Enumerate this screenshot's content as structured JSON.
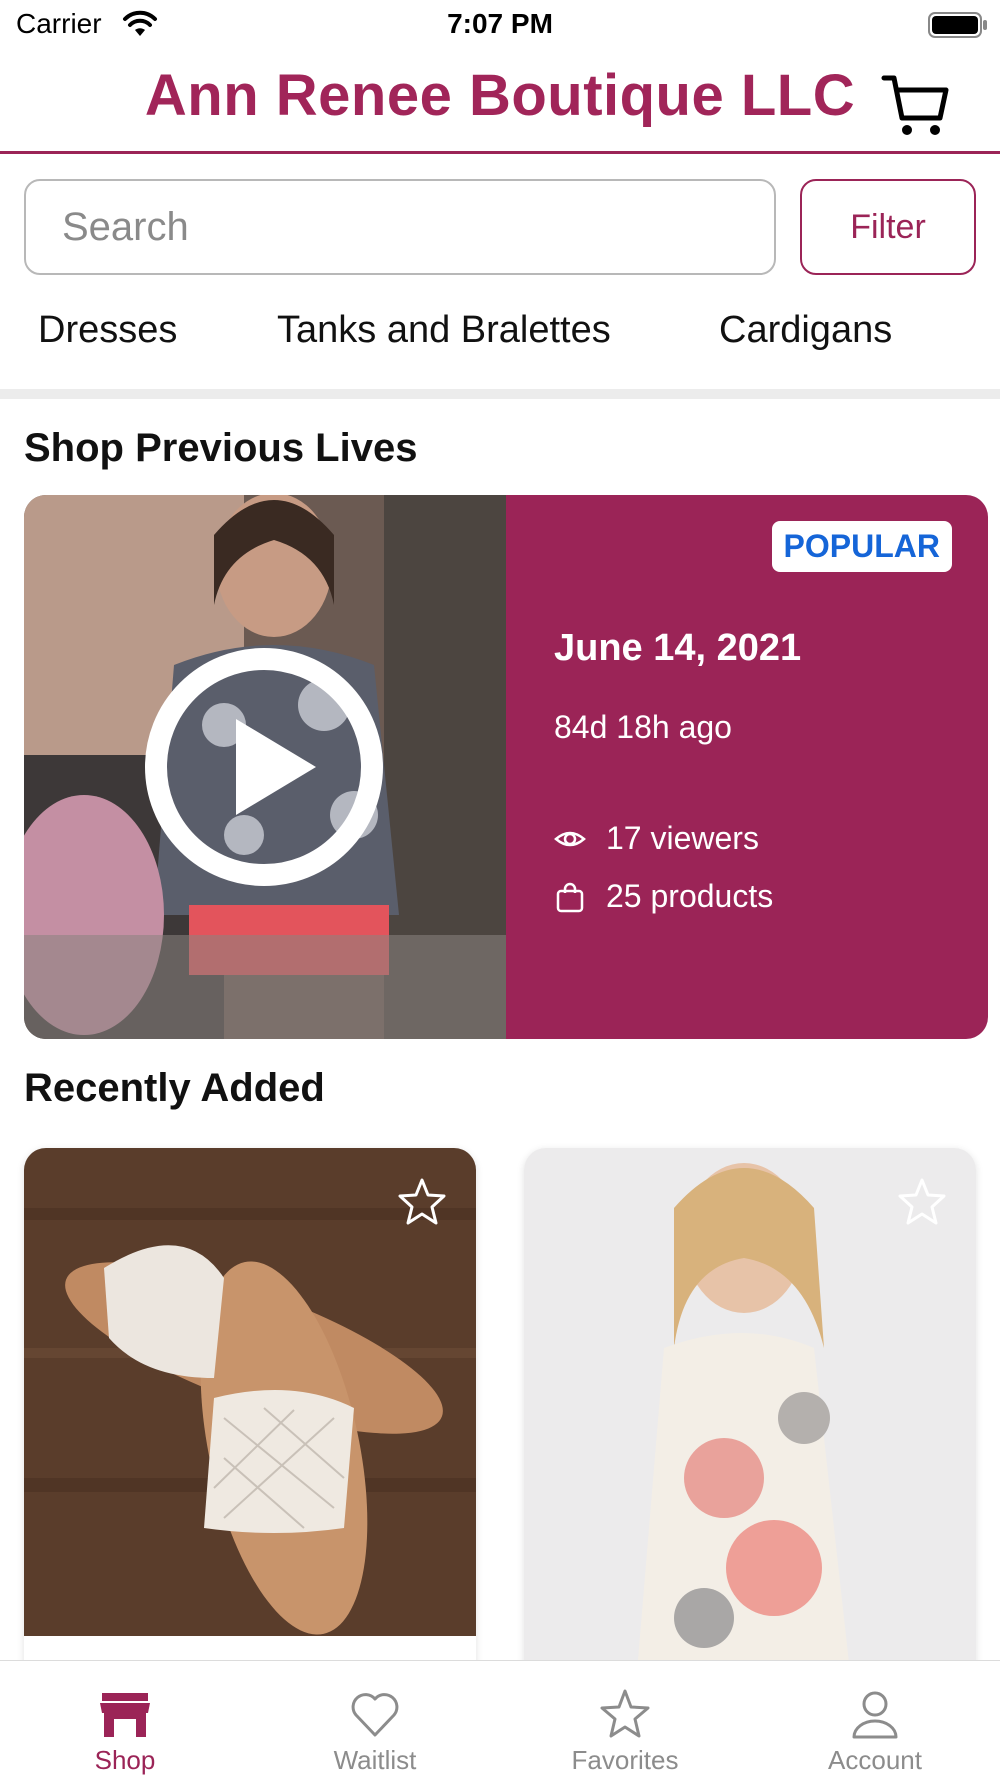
{
  "status_bar": {
    "carrier": "Carrier",
    "time": "7:07 PM"
  },
  "header": {
    "title": "Ann Renee Boutique LLC",
    "cart_icon": "cart-icon"
  },
  "search": {
    "placeholder": "Search",
    "value": "",
    "filter_label": "Filter"
  },
  "categories": [
    {
      "label": "Dresses"
    },
    {
      "label": "Tanks and Bralettes"
    },
    {
      "label": "Cardigans"
    }
  ],
  "previous_lives": {
    "section_title": "Shop Previous Lives",
    "live": {
      "badge": "POPULAR",
      "date": "June 14, 2021",
      "ago": "84d 18h ago",
      "viewers": "17 viewers",
      "products": "25 products"
    }
  },
  "recently_added": {
    "section_title": "Recently Added",
    "products": [
      {
        "image": "quilted-white-slide-sandals",
        "favorite_icon": "star-outline-icon"
      },
      {
        "image": "floral-maxi-dress",
        "favorite_icon": "star-outline-icon"
      }
    ]
  },
  "bottom_nav": {
    "items": [
      {
        "label": "Shop",
        "icon": "storefront-icon",
        "active": true
      },
      {
        "label": "Waitlist",
        "icon": "heart-icon",
        "active": false
      },
      {
        "label": "Favorites",
        "icon": "star-icon",
        "active": false
      },
      {
        "label": "Account",
        "icon": "person-icon",
        "active": false
      }
    ]
  },
  "colors": {
    "brand": "#9b2457",
    "badge_text": "#1565d8",
    "inactive": "#8c8c8c"
  }
}
